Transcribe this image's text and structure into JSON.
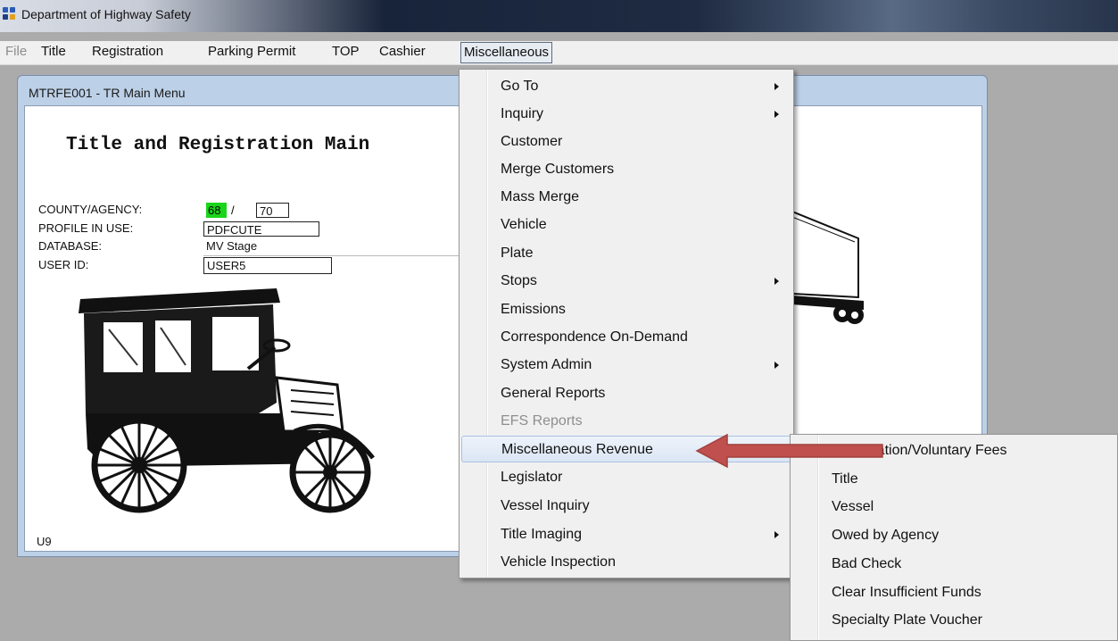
{
  "window": {
    "title": "Department of Highway Safety"
  },
  "menubar": {
    "items": [
      {
        "label": "File",
        "enabled": false
      },
      {
        "label": "Title",
        "enabled": true
      },
      {
        "label": "Registration",
        "enabled": true
      },
      {
        "label": "Parking Permit",
        "enabled": true
      },
      {
        "label": "TOP",
        "enabled": true
      },
      {
        "label": "Cashier",
        "enabled": true
      },
      {
        "label": "Miscellaneous",
        "enabled": true,
        "active": true
      }
    ]
  },
  "child_window": {
    "title": "MTRFE001 - TR Main Menu",
    "heading": "Title and Registration Main",
    "fields": {
      "county_label": "COUNTY/AGENCY:",
      "county_value": "68",
      "agency_separator": "/",
      "agency_value": "70",
      "profile_label": "PROFILE IN USE:",
      "profile_value": "PDFCUTE",
      "database_label": "DATABASE:",
      "database_value": "MV Stage",
      "user_label": "USER ID:",
      "user_value": "USER5"
    },
    "footer_code": "U9"
  },
  "misc_menu": {
    "items": [
      {
        "label": "Go To",
        "submenu": true
      },
      {
        "label": "Inquiry",
        "submenu": true
      },
      {
        "label": "Customer"
      },
      {
        "label": "Merge Customers"
      },
      {
        "label": "Mass Merge"
      },
      {
        "label": "Vehicle"
      },
      {
        "label": "Plate"
      },
      {
        "label": "Stops",
        "submenu": true
      },
      {
        "label": "Emissions"
      },
      {
        "label": "Correspondence On-Demand"
      },
      {
        "label": "System Admin",
        "submenu": true
      },
      {
        "label": "General Reports"
      },
      {
        "label": "EFS Reports",
        "disabled": true
      },
      {
        "label": "Miscellaneous Revenue",
        "submenu": true,
        "highlighted": true
      },
      {
        "label": "Legislator"
      },
      {
        "label": "Vessel Inquiry"
      },
      {
        "label": "Title Imaging",
        "submenu": true
      },
      {
        "label": "Vehicle Inspection"
      }
    ]
  },
  "revenue_submenu": {
    "items": [
      {
        "label": "Registration/Voluntary Fees"
      },
      {
        "label": "Title"
      },
      {
        "label": "Vessel"
      },
      {
        "label": "Owed by Agency"
      },
      {
        "label": "Bad Check"
      },
      {
        "label": "Clear Insufficient Funds"
      },
      {
        "label": "Specialty Plate Voucher"
      }
    ]
  },
  "colors": {
    "desktop": "#ababab",
    "county_highlight": "#1ad61a",
    "annotation_arrow": "#c0504d"
  },
  "icons": [
    "app-icon",
    "submenu-arrow-icon",
    "annotation-arrow"
  ]
}
